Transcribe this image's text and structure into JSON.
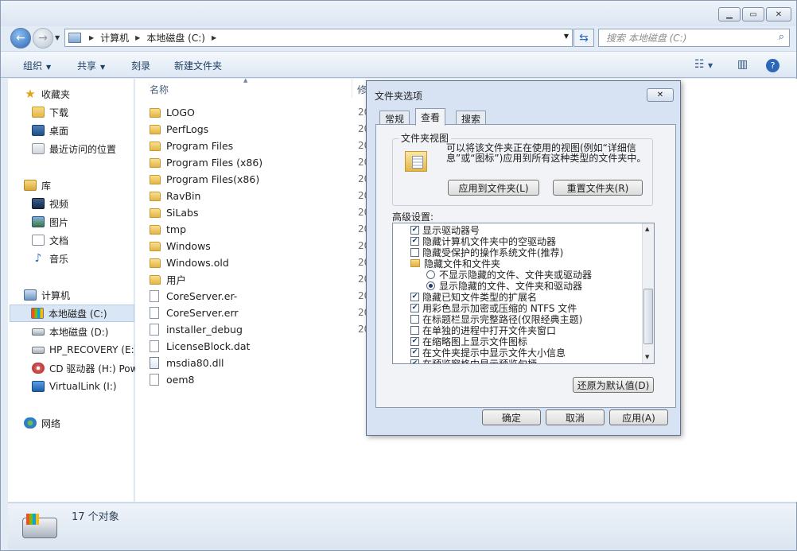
{
  "nav": {
    "breadcrumbs": [
      "计算机",
      "本地磁盘 (C:)"
    ],
    "search_placeholder": "搜索 本地磁盘 (C:)"
  },
  "toolbar": {
    "organize": "组织",
    "share": "共享",
    "burn": "刻录",
    "new_folder": "新建文件夹"
  },
  "sidebar": {
    "favorites": "收藏夹",
    "downloads": "下载",
    "desktop": "桌面",
    "recent": "最近访问的位置",
    "libraries": "库",
    "videos": "视频",
    "pictures": "图片",
    "documents": "文档",
    "music": "音乐",
    "computer": "计算机",
    "drive_c": "本地磁盘 (C:)",
    "drive_d": "本地磁盘 (D:)",
    "drive_e": "HP_RECOVERY (E:)",
    "drive_h": "CD 驱动器 (H:) Pow",
    "drive_i": "VirtualLink (I:)",
    "network": "网络"
  },
  "columns": {
    "name": "名称",
    "modified": "修"
  },
  "files": [
    {
      "name": "LOGO",
      "type": "folder"
    },
    {
      "name": "PerfLogs",
      "type": "folder"
    },
    {
      "name": "Program Files",
      "type": "folder"
    },
    {
      "name": "Program Files (x86)",
      "type": "folder"
    },
    {
      "name": "Program Files(x86)",
      "type": "folder"
    },
    {
      "name": "RavBin",
      "type": "folder"
    },
    {
      "name": "SiLabs",
      "type": "folder"
    },
    {
      "name": "tmp",
      "type": "folder"
    },
    {
      "name": "Windows",
      "type": "folder"
    },
    {
      "name": "Windows.old",
      "type": "folder"
    },
    {
      "name": "用户",
      "type": "folder"
    },
    {
      "name": "CoreServer.er-",
      "type": "file"
    },
    {
      "name": "CoreServer.err",
      "type": "file"
    },
    {
      "name": "installer_debug",
      "type": "file"
    },
    {
      "name": "LicenseBlock.dat",
      "type": "file"
    },
    {
      "name": "msdia80.dll",
      "type": "dll"
    },
    {
      "name": "oem8",
      "type": "file"
    }
  ],
  "date_stub": "20",
  "status": {
    "count": "17 个对象"
  },
  "dialog": {
    "title": "文件夹选项",
    "tabs": [
      "常规",
      "查看",
      "搜索"
    ],
    "active_tab": "查看",
    "folder_views_label": "文件夹视图",
    "folder_views_desc": "可以将该文件夹正在使用的视图(例如“详细信息”或“图标”)应用到所有这种类型的文件夹中。",
    "apply_to_folders": "应用到文件夹(L)",
    "reset_folders": "重置文件夹(R)",
    "advanced_label": "高级设置:",
    "settings": [
      {
        "kind": "check",
        "checked": true,
        "label": "显示驱动器号"
      },
      {
        "kind": "check",
        "checked": true,
        "label": "隐藏计算机文件夹中的空驱动器"
      },
      {
        "kind": "check",
        "checked": false,
        "label": "隐藏受保护的操作系统文件(推荐)"
      },
      {
        "kind": "folder",
        "label": "隐藏文件和文件夹"
      },
      {
        "kind": "radio",
        "checked": false,
        "label": "不显示隐藏的文件、文件夹或驱动器"
      },
      {
        "kind": "radio",
        "checked": true,
        "label": "显示隐藏的文件、文件夹和驱动器"
      },
      {
        "kind": "check",
        "checked": true,
        "label": "隐藏已知文件类型的扩展名"
      },
      {
        "kind": "check",
        "checked": true,
        "label": "用彩色显示加密或压缩的 NTFS 文件"
      },
      {
        "kind": "check",
        "checked": false,
        "label": "在标题栏显示完整路径(仅限经典主题)"
      },
      {
        "kind": "check",
        "checked": false,
        "label": "在单独的进程中打开文件夹窗口"
      },
      {
        "kind": "check",
        "checked": true,
        "label": "在缩略图上显示文件图标"
      },
      {
        "kind": "check",
        "checked": true,
        "label": "在文件夹提示中显示文件大小信息"
      },
      {
        "kind": "check",
        "checked": true,
        "label": "在预览窗格中显示预览句柄"
      }
    ],
    "restore_defaults": "还原为默认值(D)",
    "ok": "确定",
    "cancel": "取消",
    "apply": "应用(A)"
  }
}
